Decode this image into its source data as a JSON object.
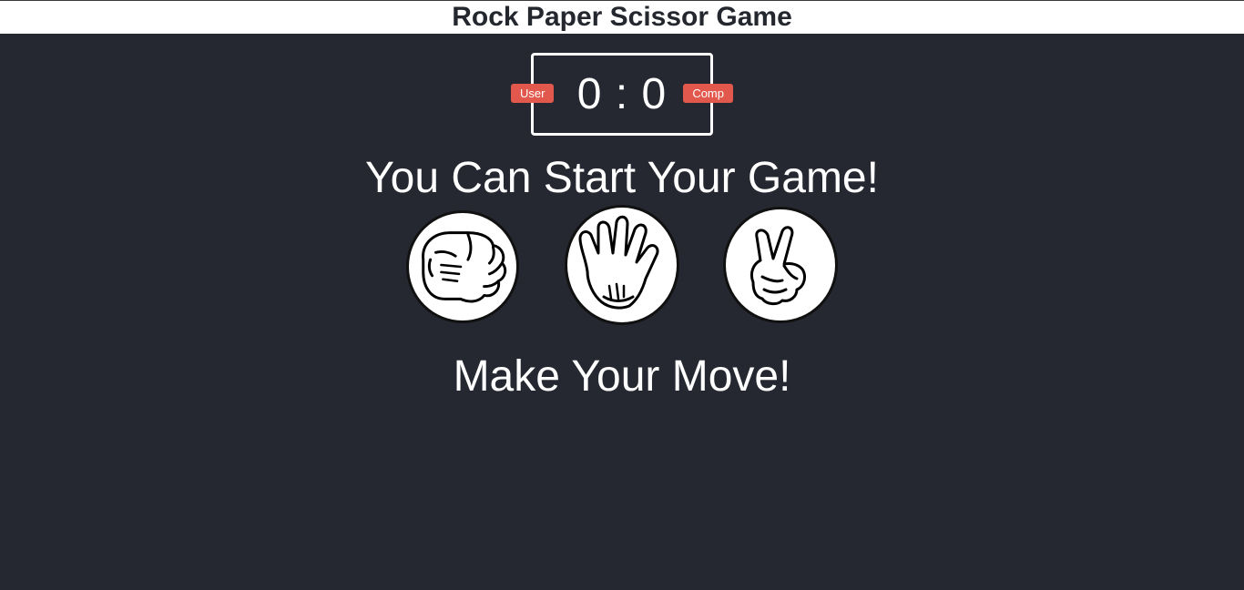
{
  "header": {
    "title": "Rock Paper Scissor Game"
  },
  "scoreboard": {
    "user_label": "User",
    "comp_label": "Comp",
    "user_score": "0",
    "separator": ":",
    "comp_score": "0"
  },
  "result_message": "You Can Start Your Game!",
  "choices": [
    {
      "id": "rock",
      "icon": "rock-hand-icon"
    },
    {
      "id": "paper",
      "icon": "paper-hand-icon"
    },
    {
      "id": "scissors",
      "icon": "scissors-hand-icon"
    }
  ],
  "action_message": "Make Your Move!",
  "colors": {
    "background": "#252830",
    "header_bg": "#ffffff",
    "badge": "#e2584d",
    "text": "#ffffff"
  }
}
